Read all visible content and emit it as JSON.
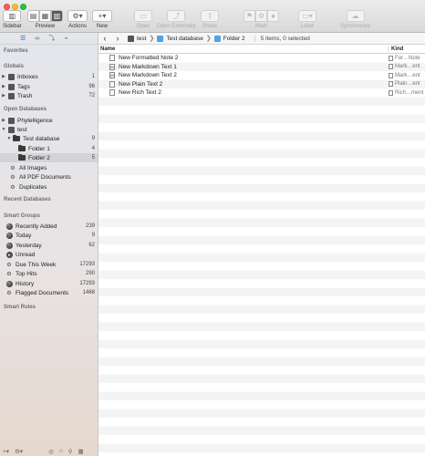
{
  "toolbar": {
    "sidebar_label": "Sidebar",
    "preview_label": "Preview",
    "actions_label": "Actions",
    "new_label": "New",
    "open_label": "Open",
    "open_externally_label": "Open Externally",
    "share_label": "Share",
    "mark_label": "Mark",
    "label_label": "Label",
    "synchronize_label": "Synchronize"
  },
  "sidebar": {
    "favorites_header": "Favorites",
    "globals_header": "Globals",
    "globals": [
      {
        "label": "Inboxes",
        "count": "1"
      },
      {
        "label": "Tags",
        "count": "96"
      },
      {
        "label": "Trash",
        "count": "72"
      }
    ],
    "open_databases_header": "Open Databases",
    "databases": [
      {
        "label": "Phytelligence",
        "count": ""
      },
      {
        "label": "test",
        "count": ""
      },
      {
        "label": "Test database",
        "count": "9"
      },
      {
        "label": "Folder 1",
        "count": "4"
      },
      {
        "label": "Folder 2",
        "count": "5"
      },
      {
        "label": "All Images",
        "count": ""
      },
      {
        "label": "All PDF Documents",
        "count": ""
      },
      {
        "label": "Duplicates",
        "count": ""
      }
    ],
    "recent_databases_header": "Recent Databases",
    "smart_groups_header": "Smart Groups",
    "smart_groups": [
      {
        "label": "Recently Added",
        "count": "239"
      },
      {
        "label": "Today",
        "count": "9"
      },
      {
        "label": "Yesterday",
        "count": "62"
      },
      {
        "label": "Unread",
        "count": ""
      },
      {
        "label": "Due This Week",
        "count": "17293"
      },
      {
        "label": "Top Hits",
        "count": "290"
      },
      {
        "label": "History",
        "count": "17293"
      },
      {
        "label": "Flagged Documents",
        "count": "1468"
      }
    ],
    "smart_rules_header": "Smart Rules"
  },
  "nav": {
    "crumbs": [
      "test",
      "Test database",
      "Folder 2"
    ],
    "status": "5 items, 0 selected"
  },
  "columns": {
    "name": "Name",
    "kind": "Kind"
  },
  "items": [
    {
      "name": "New Formatted Note 2",
      "kind": "For…Note"
    },
    {
      "name": "New Markdown Text 1",
      "kind": "Mark…ent"
    },
    {
      "name": "New Markdown Text 2",
      "kind": "Mark…ent"
    },
    {
      "name": "New Plain Text 2",
      "kind": "Plain…ent"
    },
    {
      "name": "New Rich Text 2",
      "kind": "Rich…ment"
    }
  ]
}
